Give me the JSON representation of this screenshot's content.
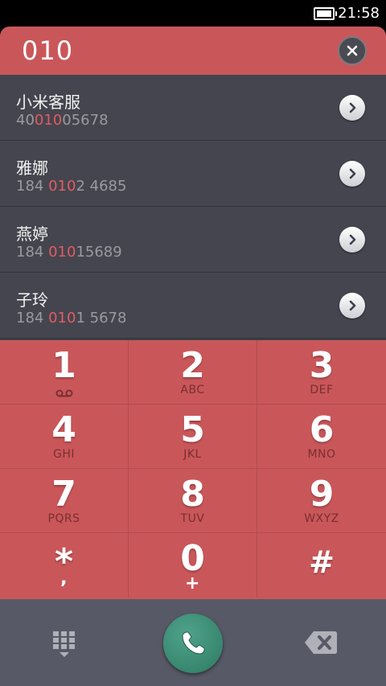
{
  "status": {
    "time": "21:58"
  },
  "search": {
    "query": "010"
  },
  "results": [
    {
      "name": "小米客服",
      "num_pre": "40",
      "num_hl": "010",
      "num_post": "05678"
    },
    {
      "name": "雅娜",
      "num_pre": "184 ",
      "num_hl": "010",
      "num_post": "2 4685"
    },
    {
      "name": "燕婷",
      "num_pre": "184 ",
      "num_hl": "010",
      "num_post": "15689"
    },
    {
      "name": "子玲",
      "num_pre": "184 ",
      "num_hl": "010",
      "num_post": "1 5678"
    }
  ],
  "keypad": [
    {
      "digit": "1",
      "letters": ""
    },
    {
      "digit": "2",
      "letters": "ABC"
    },
    {
      "digit": "3",
      "letters": "DEF"
    },
    {
      "digit": "4",
      "letters": "GHI"
    },
    {
      "digit": "5",
      "letters": "JKL"
    },
    {
      "digit": "6",
      "letters": "MNO"
    },
    {
      "digit": "7",
      "letters": "PQRS"
    },
    {
      "digit": "8",
      "letters": "TUV"
    },
    {
      "digit": "9",
      "letters": "WXYZ"
    },
    {
      "digit": "*",
      "letters": ","
    },
    {
      "digit": "0",
      "letters": "+"
    },
    {
      "digit": "#",
      "letters": ""
    }
  ],
  "colors": {
    "accent": "#c9575a",
    "highlight": "#e05c60",
    "call": "#2e7a63"
  },
  "icons": [
    "battery-icon",
    "close-icon",
    "chevron-right-icon",
    "voicemail-icon",
    "dialpad-icon",
    "phone-icon",
    "backspace-icon"
  ]
}
